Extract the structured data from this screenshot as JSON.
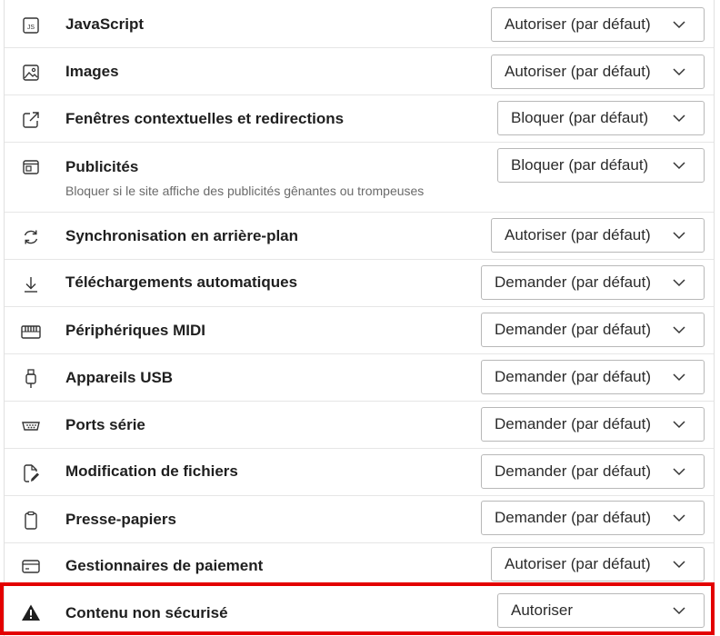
{
  "rows": [
    {
      "label": "JavaScript",
      "value": "Autoriser (par défaut)",
      "icon": "javascript-icon"
    },
    {
      "label": "Images",
      "value": "Autoriser (par défaut)",
      "icon": "image-icon"
    },
    {
      "label": "Fenêtres contextuelles et redirections",
      "value": "Bloquer (par défaut)",
      "icon": "popup-redirect-icon"
    },
    {
      "label": "Publicités",
      "sublabel": "Bloquer si le site affiche des publicités gênantes ou trompeuses",
      "value": "Bloquer (par défaut)",
      "icon": "ads-icon"
    },
    {
      "label": "Synchronisation en arrière-plan",
      "value": "Autoriser (par défaut)",
      "icon": "sync-icon"
    },
    {
      "label": "Téléchargements automatiques",
      "value": "Demander (par défaut)",
      "icon": "download-icon"
    },
    {
      "label": "Périphériques MIDI",
      "value": "Demander (par défaut)",
      "icon": "midi-keyboard-icon"
    },
    {
      "label": "Appareils USB",
      "value": "Demander (par défaut)",
      "icon": "usb-icon"
    },
    {
      "label": "Ports série",
      "value": "Demander (par défaut)",
      "icon": "serial-port-icon"
    },
    {
      "label": "Modification de fichiers",
      "value": "Demander (par défaut)",
      "icon": "file-edit-icon"
    },
    {
      "label": "Presse-papiers",
      "value": "Demander (par défaut)",
      "icon": "clipboard-icon"
    },
    {
      "label": "Gestionnaires de paiement",
      "value": "Autoriser (par défaut)",
      "icon": "payment-card-icon"
    },
    {
      "label": "Contenu non sécurisé",
      "value": "Autoriser",
      "icon": "warning-icon",
      "highlighted": true
    }
  ],
  "colors": {
    "highlight": "#e30000",
    "border": "#b8b8b8",
    "divider": "#e6e6e6"
  }
}
